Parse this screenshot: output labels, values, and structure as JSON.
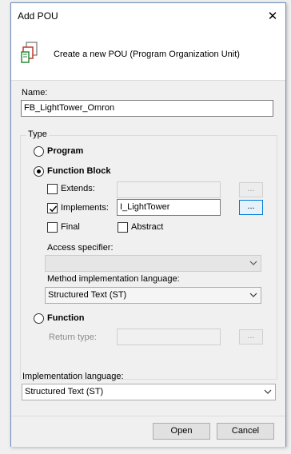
{
  "window": {
    "title": "Add POU",
    "close_glyph": "✕"
  },
  "header": {
    "description": "Create a new POU (Program Organization Unit)",
    "icon": "pou-icon"
  },
  "name": {
    "label": "Name:",
    "value": "FB_LightTower_Omron"
  },
  "type": {
    "group_label": "Type",
    "program_label": "Program",
    "function_block_label": "Function Block",
    "function_label": "Function",
    "selected": "Function Block",
    "extends": {
      "label": "Extends:",
      "checked": false,
      "value": "",
      "browse_label": "..."
    },
    "implements": {
      "label": "Implements:",
      "checked": true,
      "value": "I_LightTower",
      "browse_label": "..."
    },
    "final": {
      "label": "Final",
      "checked": false
    },
    "abstract": {
      "label": "Abstract",
      "checked": false
    },
    "access_specifier": {
      "label": "Access specifier:",
      "value": ""
    },
    "method_language": {
      "label": "Method implementation language:",
      "value": "Structured Text (ST)"
    },
    "return_type": {
      "label": "Return type:",
      "value": "",
      "browse_label": "..."
    }
  },
  "implementation_language": {
    "label": "Implementation language:",
    "value": "Structured Text (ST)"
  },
  "buttons": {
    "open": "Open",
    "cancel": "Cancel"
  },
  "colors": {
    "accent": "#0078d7",
    "border": "#6f8fbf"
  }
}
